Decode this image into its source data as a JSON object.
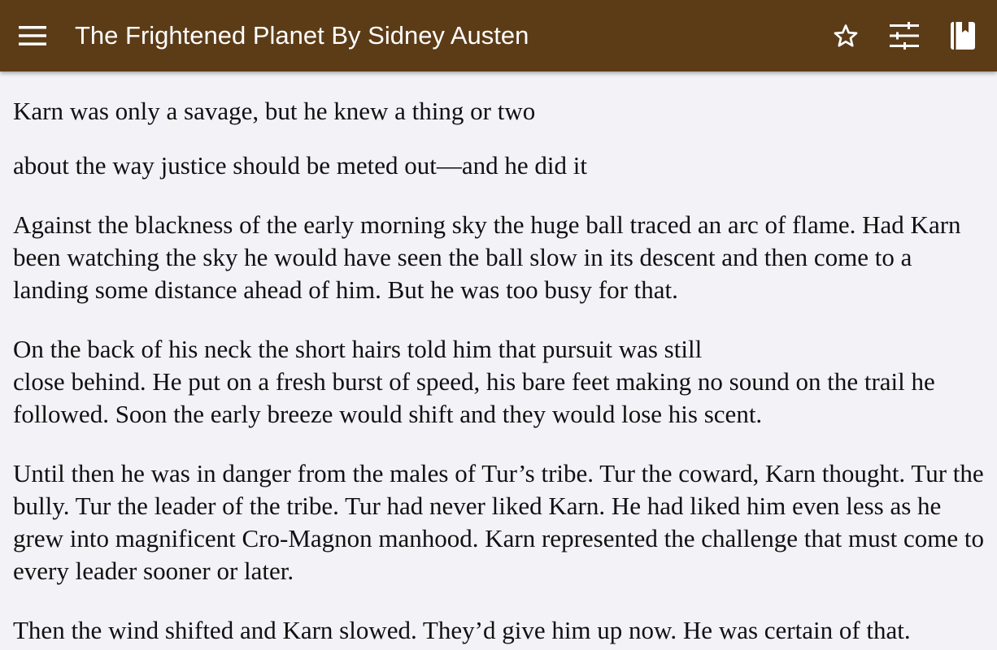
{
  "toolbar": {
    "title": "The Frightened Planet By Sidney Austen",
    "background_color": "#5c3c17",
    "icons": [
      "menu-icon",
      "star-icon",
      "tune-icon",
      "book-icon"
    ]
  },
  "content": {
    "paragraphs": [
      "Karn was only a savage, but he knew a thing or two",
      "about the way justice should be meted out—and he did it",
      "Against the blackness of the early morning sky the huge ball traced an arc of flame. Had Karn been watching the sky he would have seen the ball slow in its descent and then come to a landing some distance ahead of him. But he was too busy for that.",
      "On the back of his neck the short hairs told him that pursuit was still",
      "close behind. He put on a fresh burst of speed, his bare feet making no sound on the trail he followed. Soon the early breeze would shift and they would lose his scent.",
      "Until then he was in danger from the males of Tur’s tribe. Tur the coward, Karn thought. Tur the bully. Tur the leader of the tribe. Tur had never liked Karn. He had liked him even less as he grew into magnificent Cro-Magnon manhood. Karn represented the challenge that must come to every leader sooner or later.",
      "Then the wind shifted and Karn slowed. They’d give him up now. He was certain of that."
    ]
  }
}
